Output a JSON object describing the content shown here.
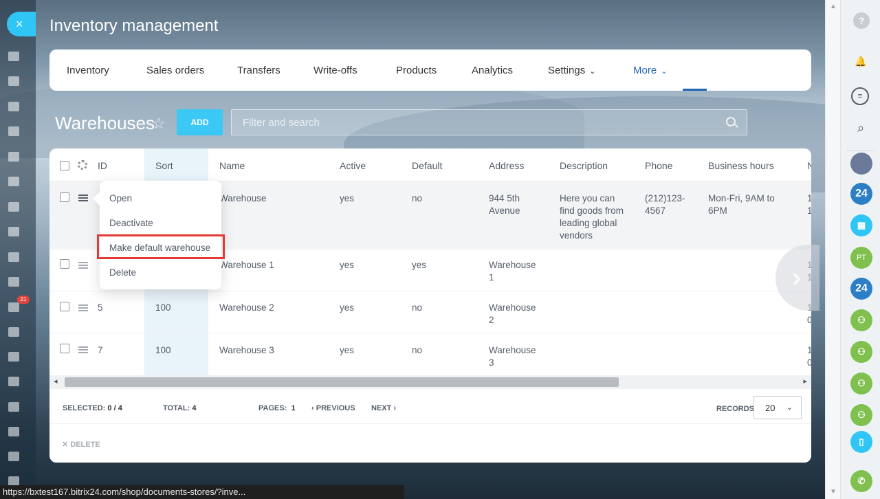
{
  "window": {
    "title": "Inventory management"
  },
  "close_label": "×",
  "nav": {
    "items": [
      {
        "label": "Inventory"
      },
      {
        "label": "Sales orders"
      },
      {
        "label": "Transfers"
      },
      {
        "label": "Write-offs"
      },
      {
        "label": "Products"
      },
      {
        "label": "Analytics"
      },
      {
        "label": "Settings"
      },
      {
        "label": "More"
      }
    ]
  },
  "toolbar": {
    "title": "Warehouses",
    "add_label": "ADD",
    "search_placeholder": "Filter and search"
  },
  "grid": {
    "columns": [
      "ID",
      "Sort",
      "Name",
      "Active",
      "Default",
      "Address",
      "Description",
      "Phone",
      "Business hours",
      "N"
    ],
    "rows": [
      {
        "id": "",
        "sort": "",
        "name": "Warehouse",
        "active": "yes",
        "default": "no",
        "address": "944 5th Avenue",
        "description": "Here you can find goods from leading global vendors",
        "phone": "(212)123-4567",
        "hours": "Mon-Fri, 9AM to 6PM",
        "extra": "1 1"
      },
      {
        "id": "",
        "sort": "",
        "name": "Warehouse 1",
        "active": "yes",
        "default": "yes",
        "address": "Warehouse 1",
        "description": "",
        "phone": "",
        "hours": "",
        "extra": "1 1"
      },
      {
        "id": "5",
        "sort": "100",
        "name": "Warehouse 2",
        "active": "yes",
        "default": "no",
        "address": "Warehouse 2",
        "description": "",
        "phone": "",
        "hours": "",
        "extra": "1 0"
      },
      {
        "id": "7",
        "sort": "100",
        "name": "Warehouse 3",
        "active": "yes",
        "default": "no",
        "address": "Warehouse 3",
        "description": "",
        "phone": "",
        "hours": "",
        "extra": "1 0"
      }
    ]
  },
  "context_menu": {
    "items": [
      "Open",
      "Deactivate",
      "Make default warehouse",
      "Delete"
    ],
    "highlighted": "Make default warehouse"
  },
  "footer": {
    "selected_label": "SELECTED:",
    "selected_value": "0 / 4",
    "total_label": "TOTAL:",
    "total_value": "4",
    "pages_label": "PAGES:",
    "pages_value": "1",
    "previous_label": "PREVIOUS",
    "next_label": "NEXT",
    "records_label": "RECORDS:",
    "records_value": "20",
    "delete_label": "DELETE"
  },
  "left_sidebar": {
    "badge": "21"
  },
  "right_bar": {
    "help": "?",
    "avatars": [
      "24",
      "PT",
      "24"
    ]
  },
  "status_url": "https://bxtest167.bitrix24.com/shop/documents-stores/?inve...",
  "colors": {
    "accent": "#2fc6f6",
    "add_button": "#3bc8f5",
    "nav_active": "#2066b0",
    "highlight_box": "#e53935",
    "avatar_blue": "#2c7fc6",
    "avatar_green": "#7fc04e",
    "avatar_teal": "#2fc6f6"
  }
}
